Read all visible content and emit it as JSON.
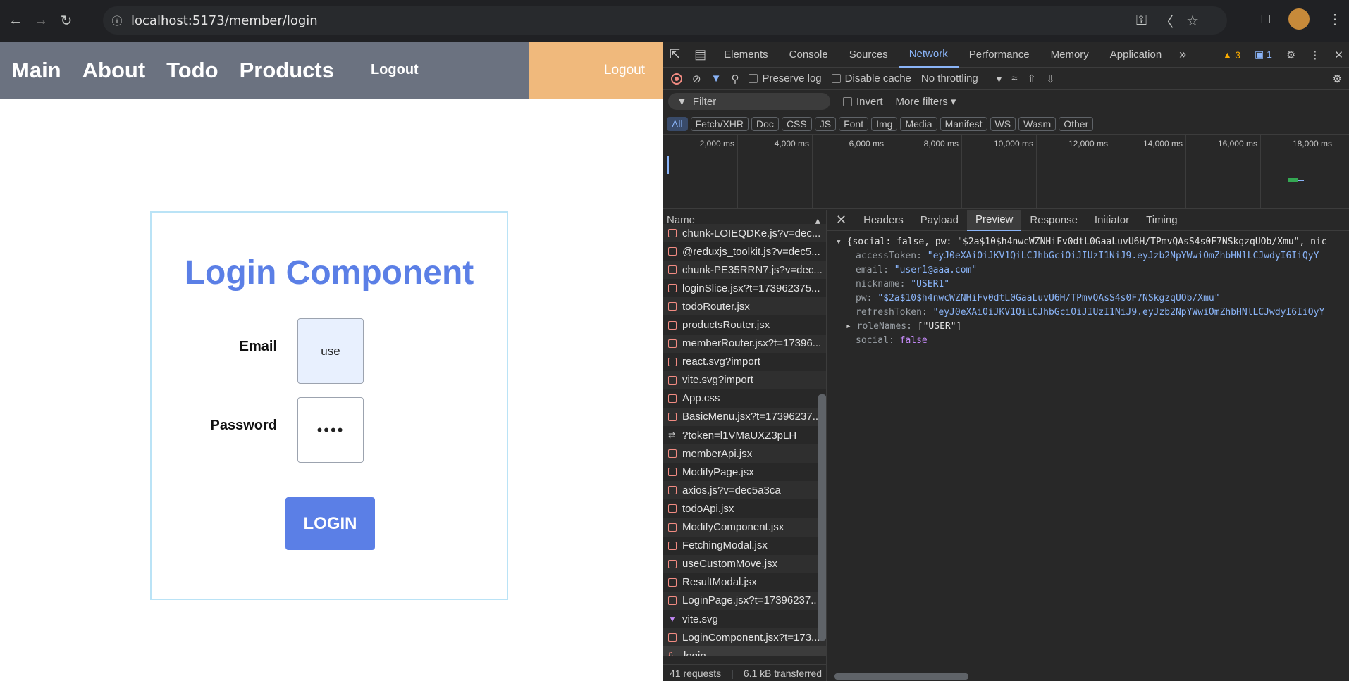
{
  "browser": {
    "url": "localhost:5173/member/login"
  },
  "app": {
    "nav": {
      "links": [
        "Main",
        "About",
        "Todo",
        "Products"
      ],
      "logout": "Logout",
      "logout_right": "Logout"
    },
    "login": {
      "title": "Login Component",
      "email_label": "Email",
      "email_value": "use",
      "password_label": "Password",
      "password_value": "••••",
      "button": "LOGIN"
    }
  },
  "devtools": {
    "tabs": [
      "Elements",
      "Console",
      "Sources",
      "Network",
      "Performance",
      "Memory",
      "Application"
    ],
    "active_tab": "Network",
    "warnings": "3",
    "messages": "1",
    "toolbar": {
      "preserve_log": "Preserve log",
      "disable_cache": "Disable cache",
      "throttling": "No throttling"
    },
    "filter": {
      "placeholder": "Filter",
      "invert": "Invert",
      "more_filters": "More filters"
    },
    "types": [
      "All",
      "Fetch/XHR",
      "Doc",
      "CSS",
      "JS",
      "Font",
      "Img",
      "Media",
      "Manifest",
      "WS",
      "Wasm",
      "Other"
    ],
    "timeline_ticks": [
      "2,000 ms",
      "4,000 ms",
      "6,000 ms",
      "8,000 ms",
      "10,000 ms",
      "12,000 ms",
      "14,000 ms",
      "16,000 ms",
      "18,000 ms"
    ],
    "requests_header": "Name",
    "requests": [
      "chunk-LOIEQDKe.js?v=dec...",
      "@reduxjs_toolkit.js?v=dec5...",
      "chunk-PE35RRN7.js?v=dec...",
      "loginSlice.jsx?t=173962375...",
      "todoRouter.jsx",
      "productsRouter.jsx",
      "memberRouter.jsx?t=17396...",
      "react.svg?import",
      "vite.svg?import",
      "App.css",
      "BasicMenu.jsx?t=17396237...",
      "?token=l1VMaUXZ3pLH",
      "memberApi.jsx",
      "ModifyPage.jsx",
      "axios.js?v=dec5a3ca",
      "todoApi.jsx",
      "ModifyComponent.jsx",
      "FetchingModal.jsx",
      "useCustomMove.jsx",
      "ResultModal.jsx",
      "LoginPage.jsx?t=17396237...",
      "vite.svg",
      "LoginComponent.jsx?t=173...",
      "login"
    ],
    "summary": {
      "requests": "41 requests",
      "transferred": "6.1 kB transferred"
    },
    "preview_tabs": [
      "Headers",
      "Payload",
      "Preview",
      "Response",
      "Initiator",
      "Timing"
    ],
    "active_preview_tab": "Preview",
    "preview": {
      "summary": "{social: false, pw: \"$2a$10$h4nwcWZNHiFv0dtL0GaaLuvU6H/TPmvQAsS4s0F7NSkgzqUOb/Xmu\", nic",
      "access_token_key": "accessToken:",
      "access_token_val": "\"eyJ0eXAiOiJKV1QiLCJhbGciOiJIUzI1NiJ9.eyJzb2NpYWwiOmZhbHNlLCJwdyI6IiQyY",
      "email_key": "email:",
      "email_val": "\"user1@aaa.com\"",
      "nickname_key": "nickname:",
      "nickname_val": "\"USER1\"",
      "pw_key": "pw:",
      "pw_val": "\"$2a$10$h4nwcWZNHiFv0dtL0GaaLuvU6H/TPmvQAsS4s0F7NSkgzqUOb/Xmu\"",
      "refresh_token_key": "refreshToken:",
      "refresh_token_val": "\"eyJ0eXAiOiJKV1QiLCJhbGciOiJIUzI1NiJ9.eyJzb2NpYWwiOmZhbHNlLCJwdyI6IiQyY",
      "role_names_key": "roleNames:",
      "role_names_val": "[\"USER\"]",
      "social_key": "social:",
      "social_val": "false"
    }
  }
}
